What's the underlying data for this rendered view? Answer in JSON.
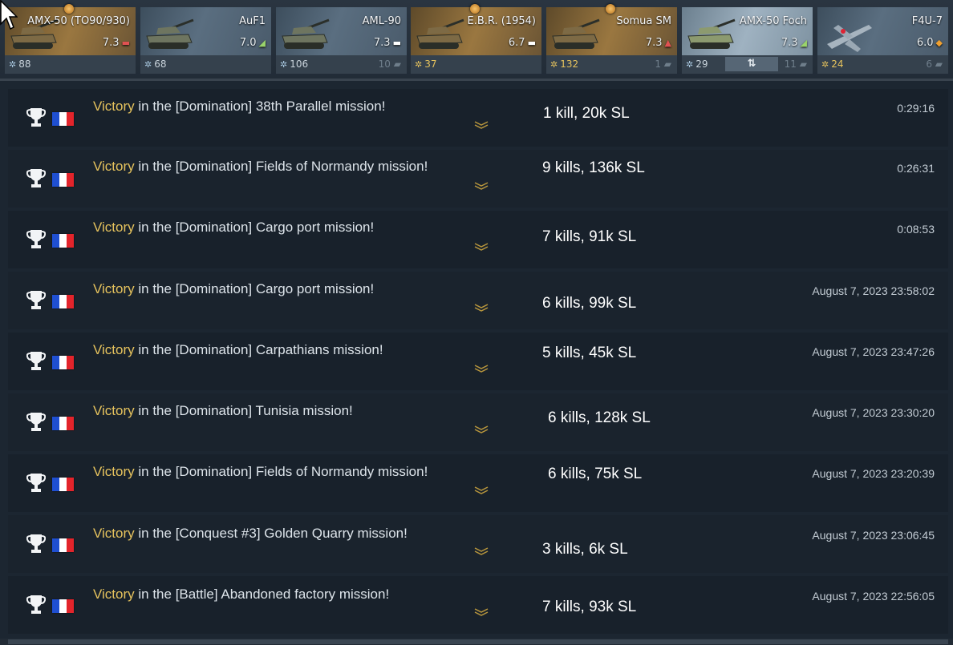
{
  "slots": [
    {
      "name": "AMX-50 (TO90/930)",
      "br": "7.3",
      "crew": "88",
      "spare": "",
      "premium": true,
      "selected": false,
      "aircraft": false,
      "crew_gold": false,
      "br_marker": "▬",
      "marker_color": "#e05252",
      "reward_icon": true
    },
    {
      "name": "AuF1",
      "br": "7.0",
      "crew": "68",
      "spare": "",
      "premium": false,
      "selected": false,
      "aircraft": false,
      "crew_gold": false,
      "br_marker": "◢",
      "marker_color": "#9ad36b",
      "reward_icon": false
    },
    {
      "name": "AML-90",
      "br": "7.3",
      "crew": "106",
      "spare": "10",
      "premium": false,
      "selected": false,
      "aircraft": false,
      "crew_gold": false,
      "br_marker": "▬",
      "marker_color": "#ffffff",
      "reward_icon": false
    },
    {
      "name": "E.B.R. (1954)",
      "br": "6.7",
      "crew": "37",
      "spare": "",
      "premium": true,
      "selected": false,
      "aircraft": false,
      "crew_gold": true,
      "br_marker": "▬",
      "marker_color": "#ffffff",
      "reward_icon": true
    },
    {
      "name": "Somua SM",
      "br": "7.3",
      "crew": "132",
      "spare": "1",
      "premium": true,
      "selected": false,
      "aircraft": false,
      "crew_gold": true,
      "br_marker": "▲",
      "marker_color": "#e05252",
      "reward_icon": true
    },
    {
      "name": "AMX-50 Foch",
      "br": "7.3",
      "crew": "29",
      "spare": "11",
      "premium": false,
      "selected": true,
      "aircraft": false,
      "crew_gold": false,
      "br_marker": "◢",
      "marker_color": "#9ad36b",
      "reward_icon": false,
      "swap_label": "⇅"
    },
    {
      "name": "F4U-7",
      "br": "6.0",
      "crew": "24",
      "spare": "6",
      "premium": false,
      "selected": false,
      "aircraft": true,
      "crew_gold": true,
      "br_marker": "◆",
      "marker_color": "#f0a030",
      "reward_icon": false
    }
  ],
  "battles": [
    {
      "victory": "Victory",
      "mission": " in the [Domination] 38th Parallel mission!",
      "stats": "1 kill, 20k SL",
      "time": "0:29:16"
    },
    {
      "victory": "Victory",
      "mission": " in the [Domination] Fields of Normandy mission!",
      "stats": "9 kills, 136k SL",
      "time": "0:26:31"
    },
    {
      "victory": "Victory",
      "mission": " in the [Domination] Cargo port mission!",
      "stats": "7 kills, 91k SL",
      "time": "0:08:53"
    },
    {
      "victory": "Victory",
      "mission": " in the [Domination] Cargo port mission!",
      "stats": "6 kills, 99k SL",
      "time": "August 7, 2023 23:58:02"
    },
    {
      "victory": "Victory",
      "mission": " in the [Domination] Carpathians mission!",
      "stats": "5 kills, 45k SL",
      "time": "August 7, 2023 23:47:26"
    },
    {
      "victory": "Victory",
      "mission": " in the [Domination] Tunisia mission!",
      "stats": "6 kills, 128k SL",
      "time": "August 7, 2023 23:30:20"
    },
    {
      "victory": "Victory",
      "mission": " in the [Domination] Fields of Normandy mission!",
      "stats": "6 kills, 75k SL",
      "time": "August 7, 2023 23:20:39"
    },
    {
      "victory": "Victory",
      "mission": " in the [Conquest #3] Golden Quarry mission!",
      "stats": "3 kills, 6k SL",
      "time": "August 7, 2023 23:06:45"
    },
    {
      "victory": "Victory",
      "mission": " in the [Battle] Abandoned factory mission!",
      "stats": "7 kills, 93k SL",
      "time": "August 7, 2023 22:56:05"
    }
  ],
  "flag_colors": [
    "#1f4fd1",
    "#ffffff",
    "#e3242b"
  ]
}
